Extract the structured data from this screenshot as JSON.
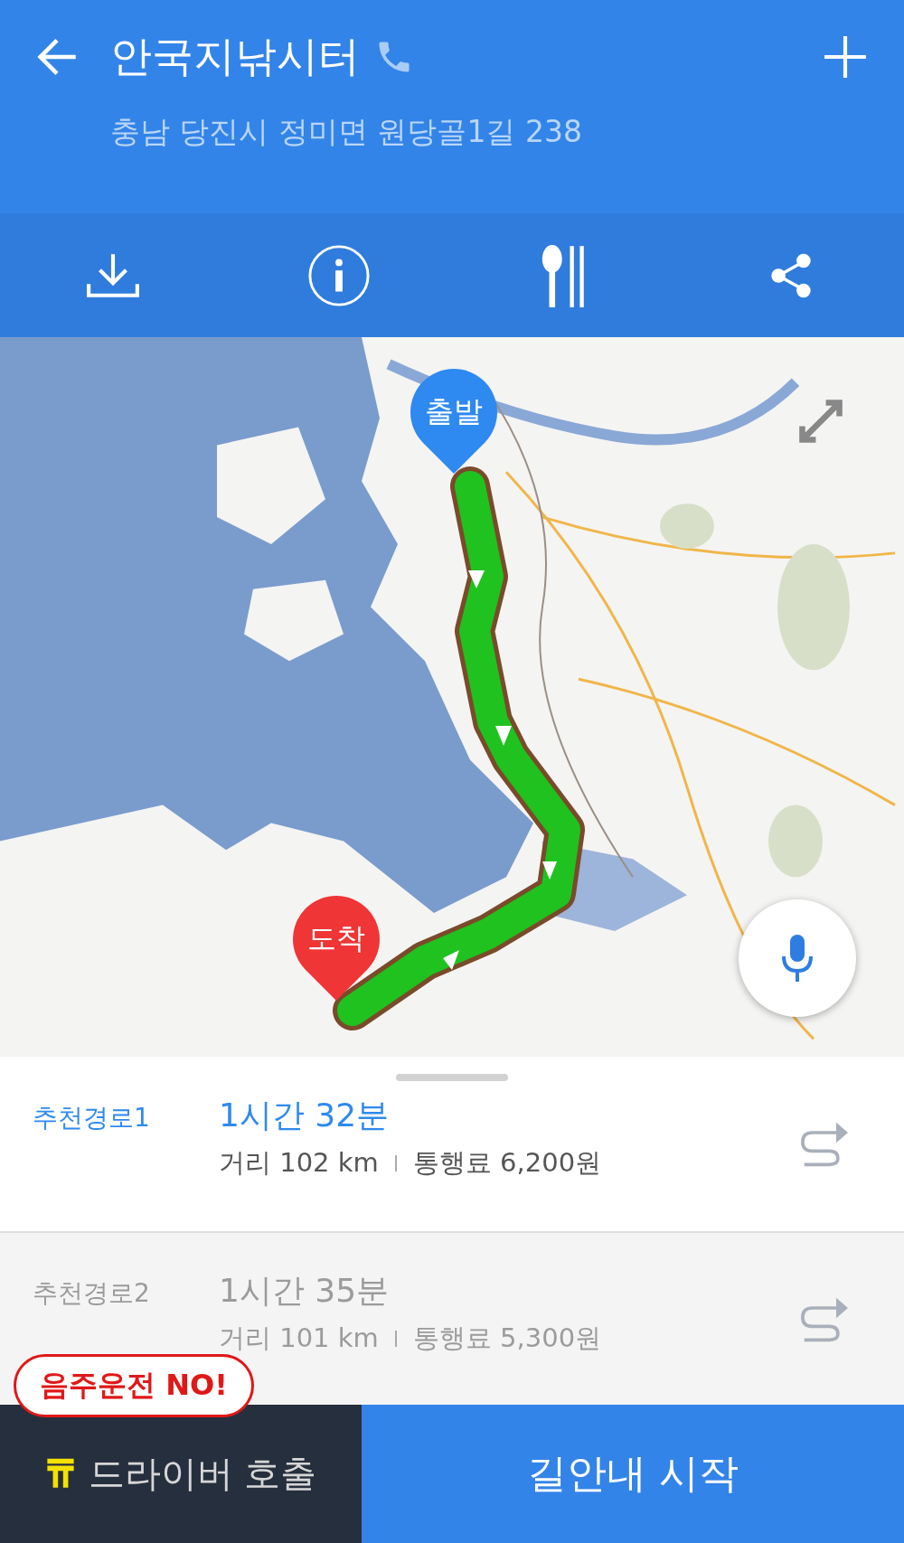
{
  "header": {
    "title": "안국지낚시터",
    "address": "충남 당진시 정미면 원당골1길 238"
  },
  "actions": [
    {
      "kind": "download"
    },
    {
      "kind": "info"
    },
    {
      "kind": "restaurant"
    },
    {
      "kind": "share"
    }
  ],
  "map": {
    "kind": "picture",
    "start_marker": "출발",
    "end_marker": "도착"
  },
  "routes": [
    {
      "name": "추천경로1",
      "time": "1시간 32분",
      "distance": "거리 102 km",
      "toll": "통행료 6,200원",
      "selected": true
    },
    {
      "name": "추천경로2",
      "time": "1시간 35분",
      "distance": "거리 101 km",
      "toll": "통행료 5,300원",
      "selected": false
    }
  ],
  "bottom": {
    "badge": "음주운전 NO!",
    "driver_button": "드라이버 호출",
    "start_button": "길안내 시작"
  }
}
